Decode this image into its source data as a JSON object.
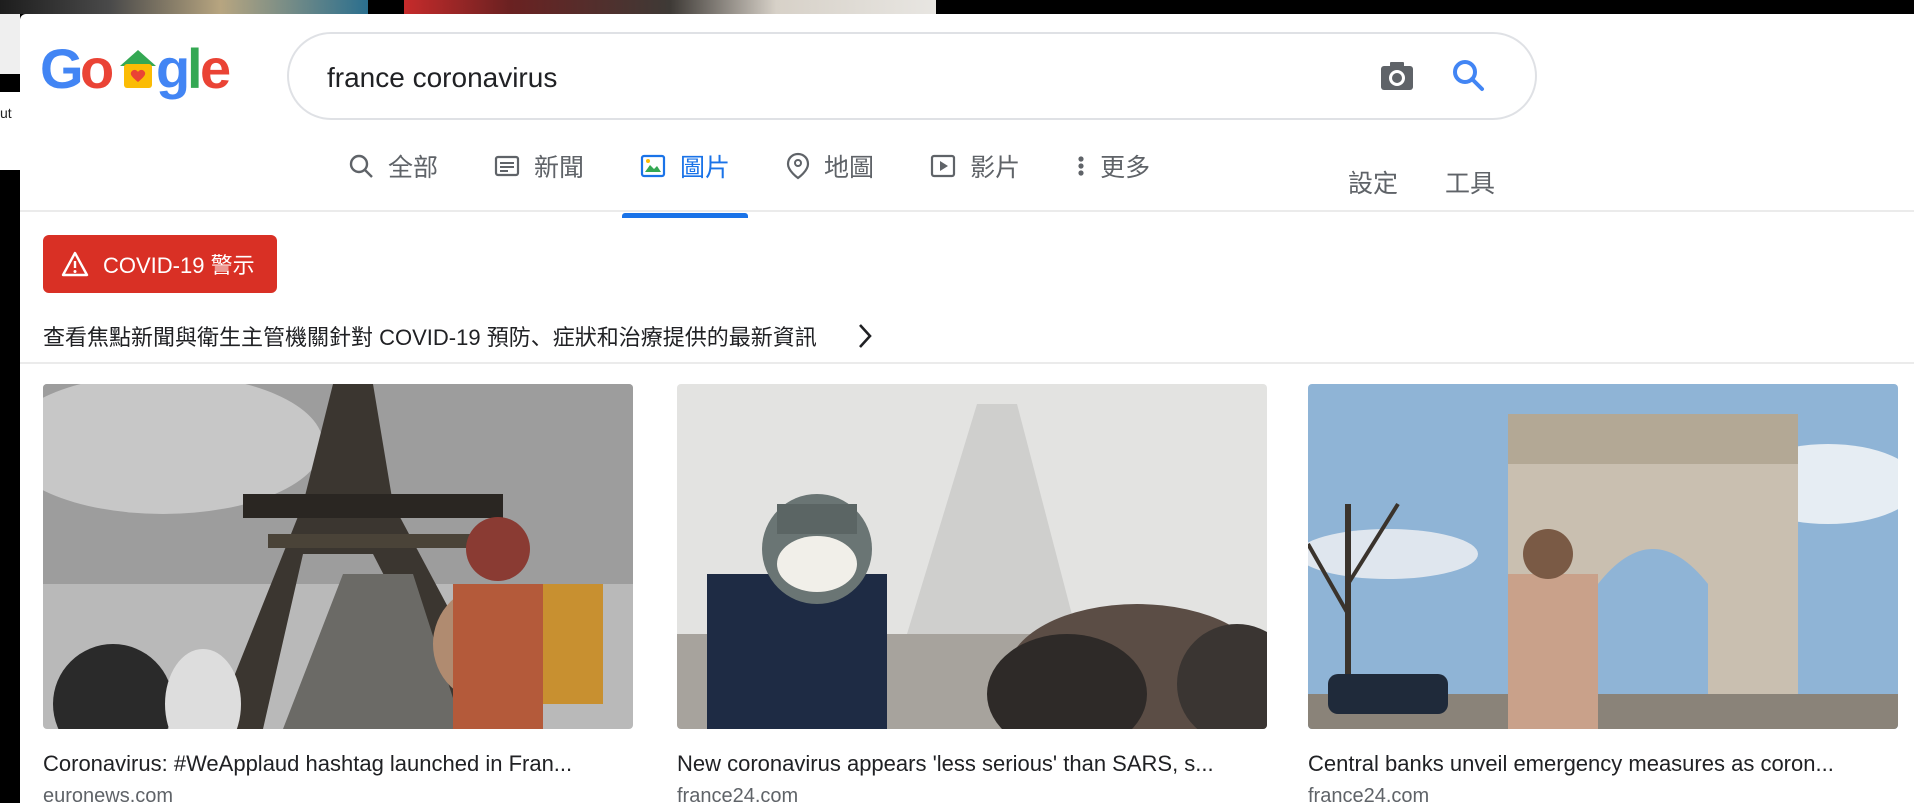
{
  "search": {
    "query": "france coronavirus",
    "logo_text": "Google"
  },
  "tabs": [
    {
      "label": "全部",
      "icon": "search-icon"
    },
    {
      "label": "新聞",
      "icon": "news-icon"
    },
    {
      "label": "圖片",
      "icon": "image-icon",
      "active": true
    },
    {
      "label": "地圖",
      "icon": "map-pin-icon"
    },
    {
      "label": "影片",
      "icon": "play-icon"
    },
    {
      "label": "更多",
      "icon": "more-vert-icon"
    }
  ],
  "tools": {
    "settings": "設定",
    "tools": "工具"
  },
  "covid": {
    "badge": "COVID-19 警示",
    "info": "查看焦點新聞與衛生主管機關針對 COVID-19 預防、症狀和治療提供的最新資訊"
  },
  "results": [
    {
      "title": "Coronavirus: #WeApplaud hashtag launched in Fran...",
      "source": "euronews.com"
    },
    {
      "title": "New coronavirus appears 'less serious' than SARS, s...",
      "source": "france24.com"
    },
    {
      "title": "Central banks unveil emergency measures as coron...",
      "source": "france24.com"
    }
  ],
  "background": {
    "partial_text": "ut"
  },
  "colors": {
    "accent": "#1a73e8",
    "alert": "#d93025"
  }
}
